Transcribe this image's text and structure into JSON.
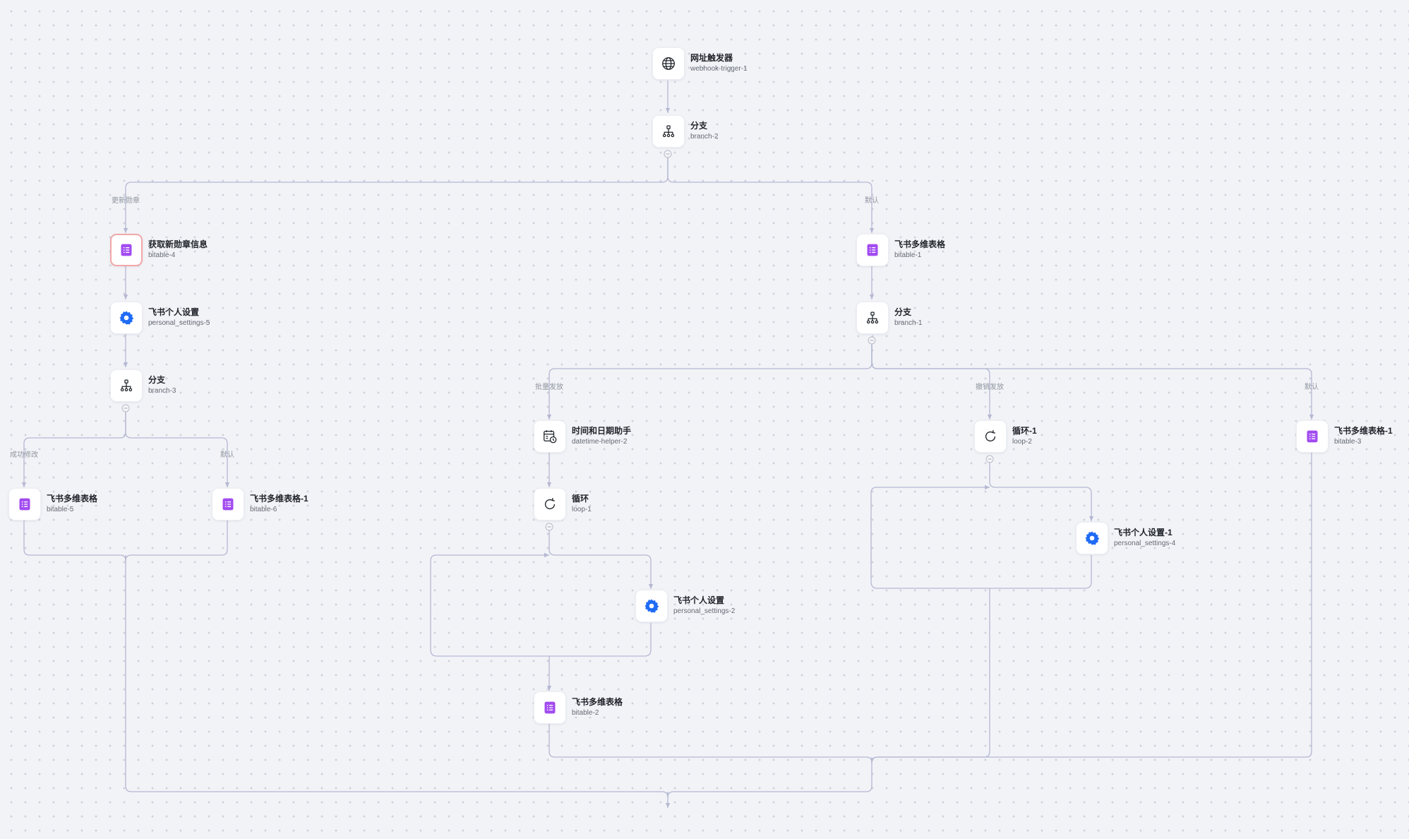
{
  "colors": {
    "canvas": "#f2f3f7",
    "edge": "#b4b8d2",
    "bitable": "#a24cf0",
    "settings": "#1f6bf5",
    "selected_border": "#f2a8a8"
  },
  "nodes": [
    {
      "id": "webhook-trigger-1",
      "title": "网址触发器",
      "subtitle": "webhook-trigger-1",
      "icon": "globe-icon"
    },
    {
      "id": "branch-2",
      "title": "分支",
      "subtitle": "branch-2",
      "icon": "branch-icon"
    },
    {
      "id": "bitable-4",
      "title": "获取新勋章信息",
      "subtitle": "bitable-4",
      "icon": "bitable-icon",
      "selected": true
    },
    {
      "id": "personal_settings-5",
      "title": "飞书个人设置",
      "subtitle": "personal_settings-5",
      "icon": "gear-icon"
    },
    {
      "id": "branch-3",
      "title": "分支",
      "subtitle": "branch-3",
      "icon": "branch-icon"
    },
    {
      "id": "bitable-5",
      "title": "飞书多维表格",
      "subtitle": "bitable-5",
      "icon": "bitable-icon"
    },
    {
      "id": "bitable-6",
      "title": "飞书多维表格-1",
      "subtitle": "bitable-6",
      "icon": "bitable-icon"
    },
    {
      "id": "bitable-1",
      "title": "飞书多维表格",
      "subtitle": "bitable-1",
      "icon": "bitable-icon"
    },
    {
      "id": "branch-1",
      "title": "分支",
      "subtitle": "branch-1",
      "icon": "branch-icon"
    },
    {
      "id": "datetime-helper-2",
      "title": "时间和日期助手",
      "subtitle": "datetime-helper-2",
      "icon": "calendar-clock-icon"
    },
    {
      "id": "loop-1",
      "title": "循环",
      "subtitle": "loop-1",
      "icon": "loop-icon"
    },
    {
      "id": "personal_settings-2",
      "title": "飞书个人设置",
      "subtitle": "personal_settings-2",
      "icon": "gear-icon"
    },
    {
      "id": "bitable-2",
      "title": "飞书多维表格",
      "subtitle": "bitable-2",
      "icon": "bitable-icon"
    },
    {
      "id": "loop-2",
      "title": "循环-1",
      "subtitle": "loop-2",
      "icon": "loop-icon"
    },
    {
      "id": "personal_settings-4",
      "title": "飞书个人设置-1",
      "subtitle": "personal_settings-4",
      "icon": "gear-icon"
    },
    {
      "id": "bitable-3",
      "title": "飞书多维表格-1",
      "subtitle": "bitable-3",
      "icon": "bitable-icon"
    }
  ],
  "edge_labels": [
    {
      "id": "update-badge",
      "text": "更新勋章"
    },
    {
      "id": "default-top",
      "text": "默认"
    },
    {
      "id": "success",
      "text": "成功修改"
    },
    {
      "id": "default-branch3",
      "text": "默认"
    },
    {
      "id": "batch-issue",
      "text": "批量发放"
    },
    {
      "id": "revoke-issue",
      "text": "撤销发放"
    },
    {
      "id": "default-branch1",
      "text": "默认"
    }
  ]
}
